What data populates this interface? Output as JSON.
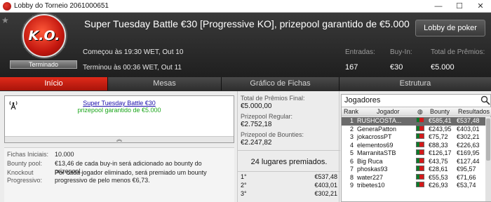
{
  "window": {
    "title": "Lobby do Torneio 2061000651",
    "minimize": "—",
    "maximize": "☐",
    "close": "✕"
  },
  "header": {
    "ko_label": "K.O.",
    "status": "Terminado",
    "title": "Super Tuesday Battle €30 [Progressive KO], prizepool garantido de €5.000",
    "lobby_button": "Lobby de poker",
    "start": "Começou às 19:30 WET, Out 10",
    "end": "Terminou às 00:36 WET, Out 11",
    "entries_label": "Entradas:",
    "entries_value": "167",
    "buyin_label": "Buy-In:",
    "buyin_value": "€30",
    "total_prize_label": "Total de Prêmios:",
    "total_prize_value": "€5.000"
  },
  "tabs": [
    {
      "label": "Início",
      "active": true
    },
    {
      "label": "Mesas",
      "active": false
    },
    {
      "label": "Gráfico de Fichas",
      "active": false
    },
    {
      "label": "Estrutura",
      "active": false
    }
  ],
  "info_box": {
    "link": "Super Tuesday Battle €30",
    "subtitle": "prizepool garantido de €5.000",
    "collapse": "︽"
  },
  "details": {
    "chips_label": "Fichas Iniciais:",
    "chips_value": "10.000",
    "bounty_label": "Bounty pool:",
    "bounty_value": "€13,46 de cada buy-in será adicionado ao bounty do prizepool.",
    "ko_label": "Knockout Progressivo:",
    "ko_value": "Por cada jogador eliminado, será premiado um bounty progressivo de pelo menos €6,73."
  },
  "prizes": {
    "final_label": "Total de Prêmios Final:",
    "final_value": "€5.000,00",
    "regular_label": "Prizepool Regular:",
    "regular_value": "€2.752,18",
    "bounties_label": "Prizepool de Bounties:",
    "bounties_value": "€2.247,82",
    "places": "24 lugares premiados.",
    "table": [
      {
        "place": "1°",
        "amount": "€537,48"
      },
      {
        "place": "2°",
        "amount": "€403,01"
      },
      {
        "place": "3°",
        "amount": "€302,21"
      }
    ]
  },
  "players": {
    "title": "Jogadores",
    "headers": {
      "rank": "Rank",
      "player": "Jogador",
      "bounty": "Bounty",
      "results": "Resultados"
    },
    "rows": [
      {
        "rank": "1",
        "name": "RUSHCOSTA...",
        "bounty": "€585,41",
        "result": "€537,48"
      },
      {
        "rank": "2",
        "name": "GeneraPatton",
        "bounty": "€243,95",
        "result": "€403,01"
      },
      {
        "rank": "3",
        "name": "jokacrossPT",
        "bounty": "€75,72",
        "result": "€302,21"
      },
      {
        "rank": "4",
        "name": "elementos69",
        "bounty": "€88,33",
        "result": "€226,63"
      },
      {
        "rank": "5",
        "name": "MarranitaSTB",
        "bounty": "€126,17",
        "result": "€169,95"
      },
      {
        "rank": "6",
        "name": "Big Ruca",
        "bounty": "€43,75",
        "result": "€127,44"
      },
      {
        "rank": "7",
        "name": "phoskas93",
        "bounty": "€28,61",
        "result": "€95,57"
      },
      {
        "rank": "8",
        "name": "water227",
        "bounty": "€55,53",
        "result": "€71,66"
      },
      {
        "rank": "9",
        "name": "tribetes10",
        "bounty": "€26,93",
        "result": "€53,74"
      }
    ]
  },
  "colors": {
    "accent_red": "#d41e10",
    "link_blue": "#1a0dab",
    "subtitle_green": "#1aa51a"
  }
}
